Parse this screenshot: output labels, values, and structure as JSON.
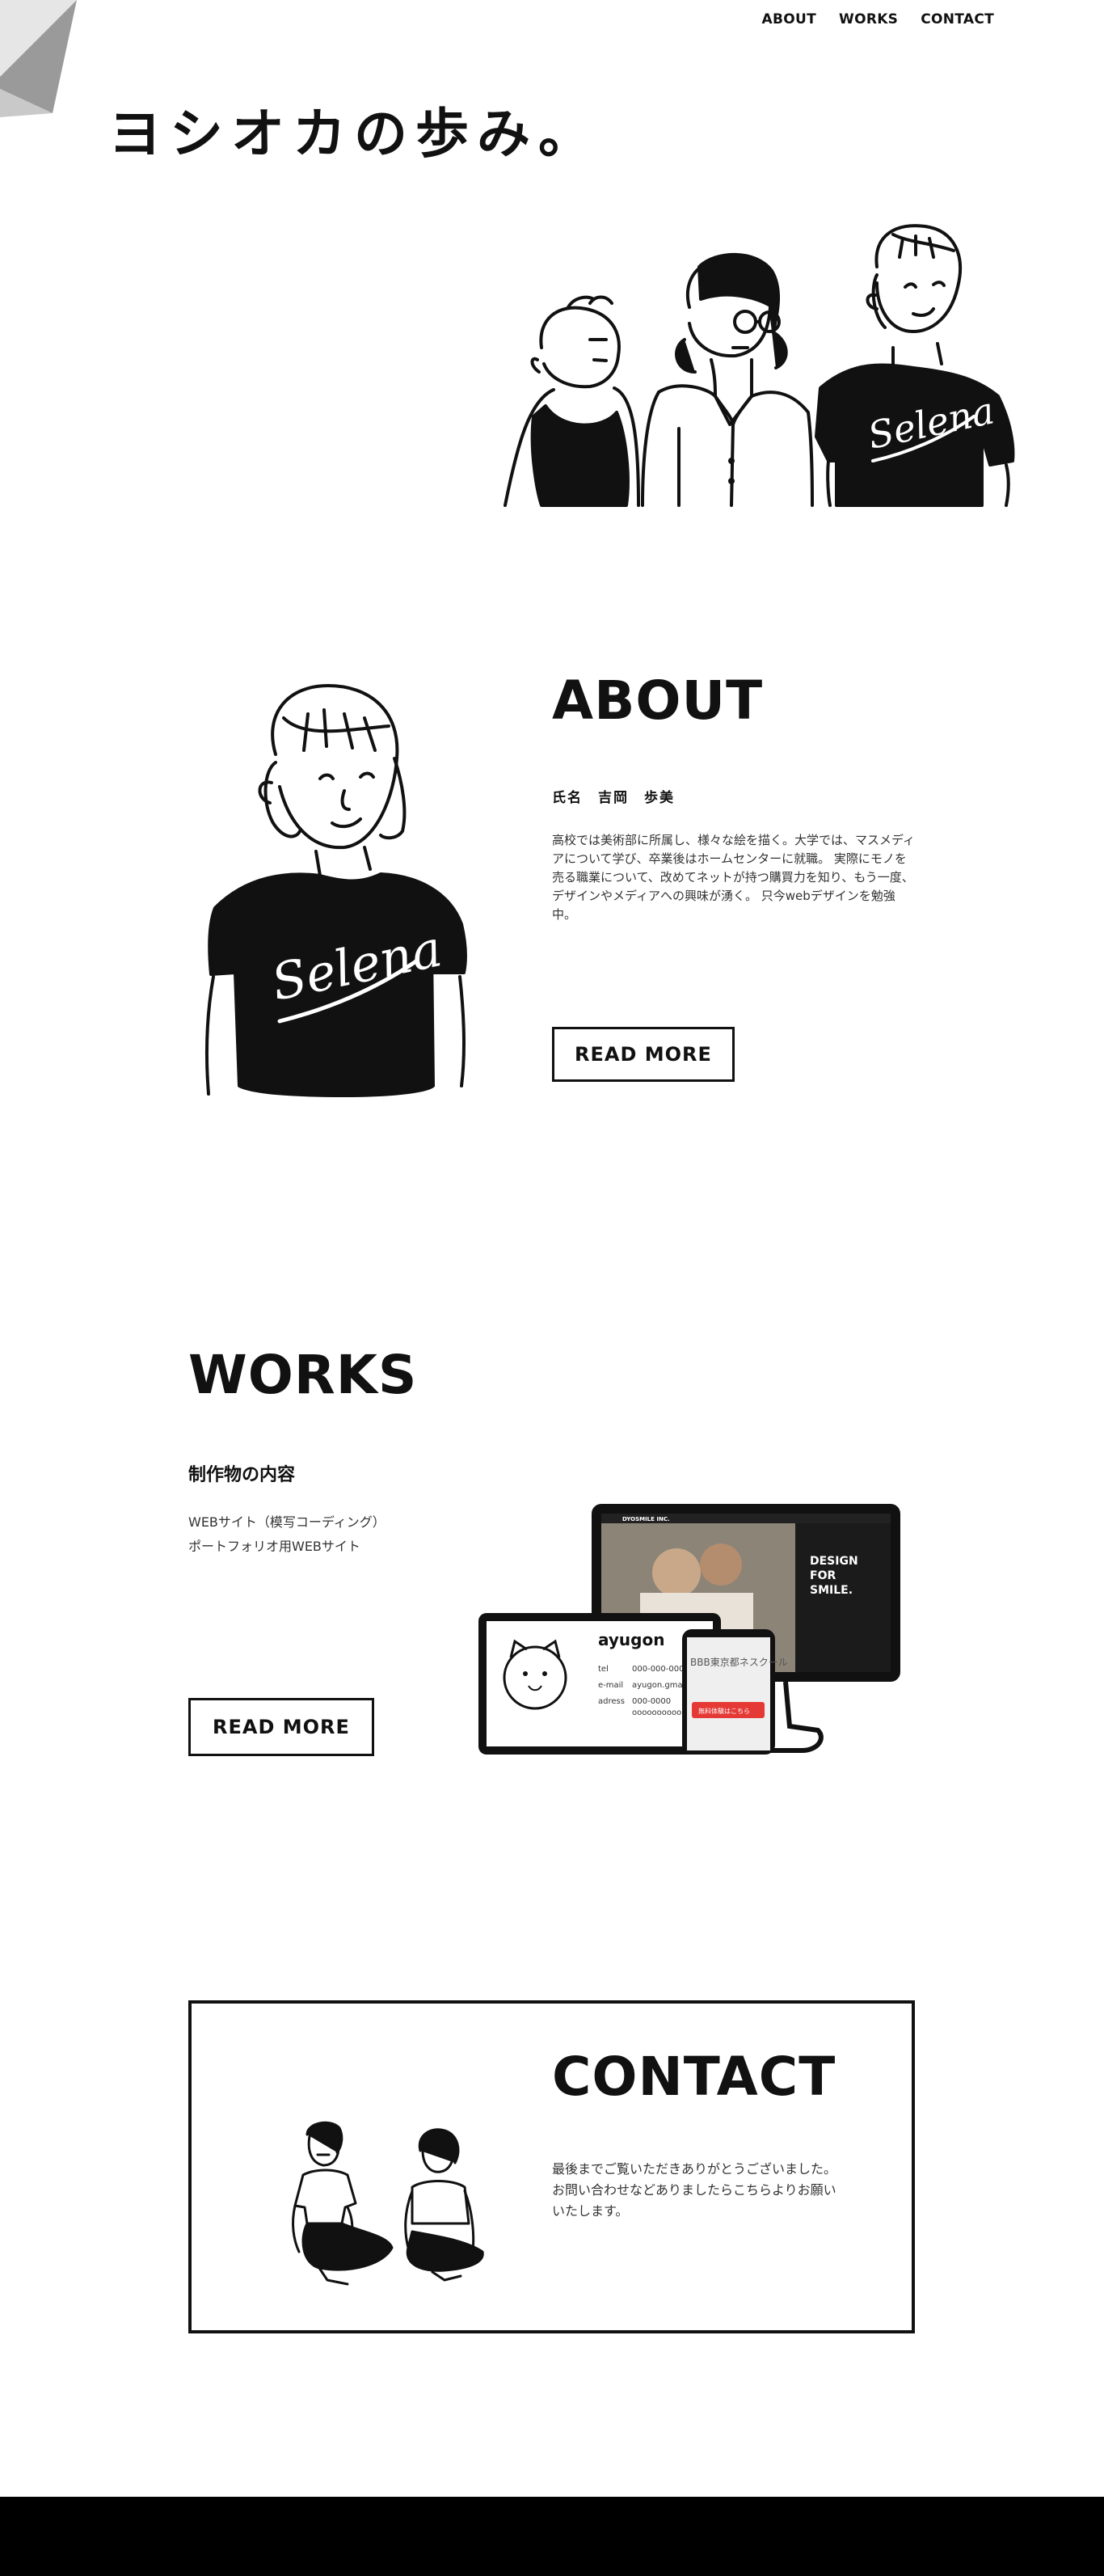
{
  "nav": {
    "about": "ABOUT",
    "works": "WORKS",
    "contact": "CONTACT"
  },
  "hero": {
    "title": "ヨシオカの歩み。",
    "shirt_text": "Selena"
  },
  "about": {
    "heading": "ABOUT",
    "name": "氏名　吉岡　歩美",
    "description": "高校では美術部に所属し、様々な絵を描く。大学では、マスメディアについて学び、卒業後はホームセンターに就職。 実際にモノを売る職業について、改めてネットが持つ購買力を知り、もう一度、デザインやメディアへの興味が湧く。 只今webデザインを勉強中。",
    "button": "READ MORE",
    "shirt_text": "Selena"
  },
  "works": {
    "heading": "WORKS",
    "subheading": "制作物の内容",
    "items": [
      "WEBサイト（模写コーディング）",
      "ポートフォリオ用WEBサイト"
    ],
    "button": "READ MORE",
    "mockup": {
      "monitor_brand": "DYOSMILE INC.",
      "monitor_copy": [
        "DESIGN",
        "FOR",
        "SMILE."
      ],
      "card_name": "ayugon",
      "card_rows": [
        {
          "label": "tel",
          "value": "000-000-000"
        },
        {
          "label": "e-mail",
          "value": "ayugon.gma"
        },
        {
          "label": "adress",
          "value": "000-0000"
        }
      ],
      "card_extra": "oooooooooo",
      "phone_text": "BBB東京都ネスクール",
      "phone_button": "無料体験はこちら",
      "accent": "#e53935"
    }
  },
  "contact": {
    "heading": "CONTACT",
    "text": "最後までご覧いただきありがとうございました。 お問い合わせなどありましたらこちらよりお願いいたします。"
  },
  "colors": {
    "text": "#111111",
    "background": "#ffffff",
    "footer": "#000000"
  }
}
